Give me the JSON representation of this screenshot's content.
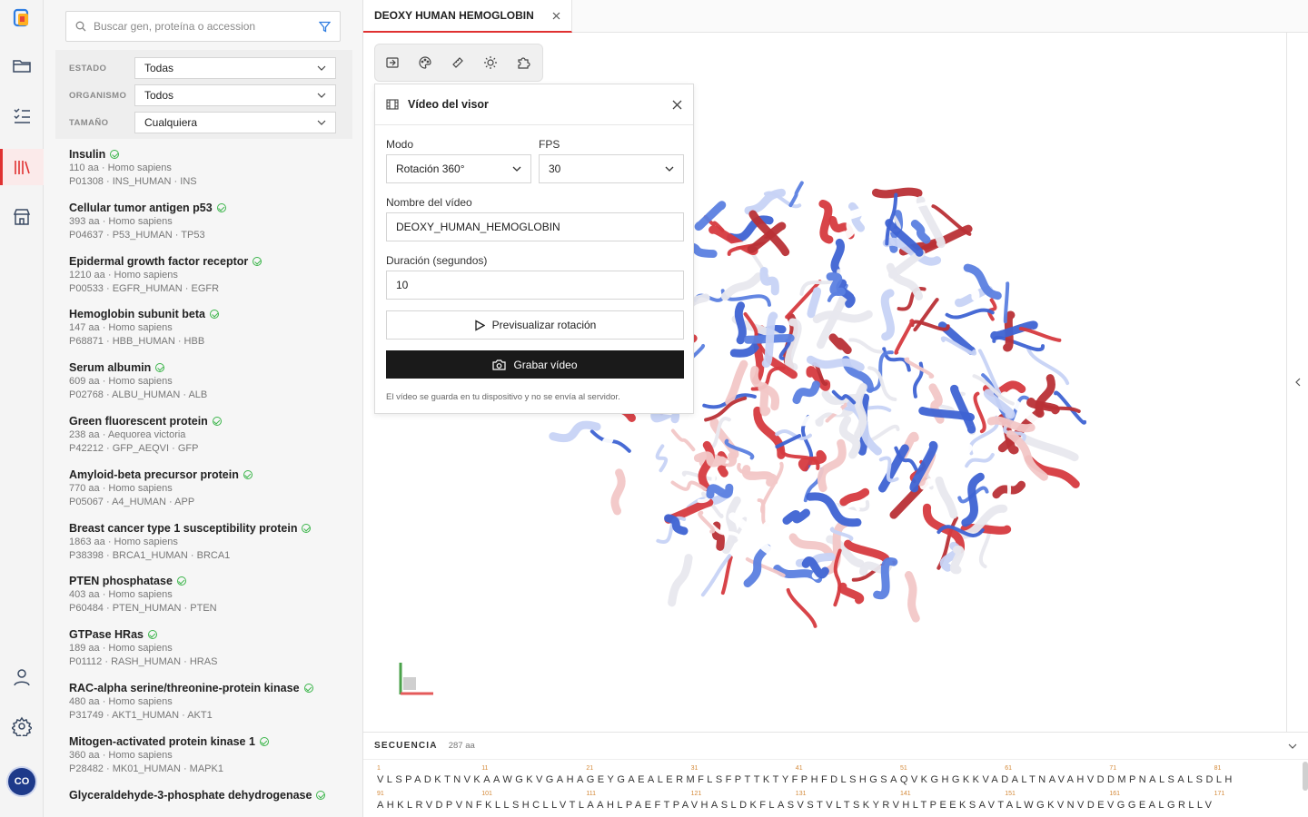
{
  "sidebar": {
    "search_placeholder": "Buscar gen, proteína o accession",
    "filters": [
      {
        "label": "ESTADO",
        "value": "Todas"
      },
      {
        "label": "ORGANISMO",
        "value": "Todos"
      },
      {
        "label": "TAMAÑO",
        "value": "Cualquiera"
      }
    ],
    "proteins": [
      {
        "name": "Insulin",
        "meta": "110 aa · Homo sapiens",
        "ids": "P01308 · INS_HUMAN · INS"
      },
      {
        "name": "Cellular tumor antigen p53",
        "meta": "393 aa · Homo sapiens",
        "ids": "P04637 · P53_HUMAN · TP53"
      },
      {
        "name": "Epidermal growth factor receptor",
        "meta": "1210 aa · Homo sapiens",
        "ids": "P00533 · EGFR_HUMAN · EGFR"
      },
      {
        "name": "Hemoglobin subunit beta",
        "meta": "147 aa · Homo sapiens",
        "ids": "P68871 · HBB_HUMAN · HBB"
      },
      {
        "name": "Serum albumin",
        "meta": "609 aa · Homo sapiens",
        "ids": "P02768 · ALBU_HUMAN · ALB"
      },
      {
        "name": "Green fluorescent protein",
        "meta": "238 aa · Aequorea victoria",
        "ids": "P42212 · GFP_AEQVI · GFP"
      },
      {
        "name": "Amyloid-beta precursor protein",
        "meta": "770 aa · Homo sapiens",
        "ids": "P05067 · A4_HUMAN · APP"
      },
      {
        "name": "Breast cancer type 1 susceptibility protein",
        "meta": "1863 aa · Homo sapiens",
        "ids": "P38398 · BRCA1_HUMAN · BRCA1"
      },
      {
        "name": "PTEN phosphatase",
        "meta": "403 aa · Homo sapiens",
        "ids": "P60484 · PTEN_HUMAN · PTEN"
      },
      {
        "name": "GTPase HRas",
        "meta": "189 aa · Homo sapiens",
        "ids": "P01112 · RASH_HUMAN · HRAS"
      },
      {
        "name": "RAC-alpha serine/threonine-protein kinase",
        "meta": "480 aa · Homo sapiens",
        "ids": "P31749 · AKT1_HUMAN · AKT1"
      },
      {
        "name": "Mitogen-activated protein kinase 1",
        "meta": "360 aa · Homo sapiens",
        "ids": "P28482 · MK01_HUMAN · MAPK1"
      },
      {
        "name": "Glyceraldehyde-3-phosphate dehydrogenase",
        "meta": "",
        "ids": ""
      }
    ]
  },
  "rail": {
    "avatar": "CO"
  },
  "tab": {
    "title": "DEOXY HUMAN HEMOGLOBIN"
  },
  "video_panel": {
    "title": "Vídeo del visor",
    "mode_label": "Modo",
    "mode_value": "Rotación 360°",
    "fps_label": "FPS",
    "fps_value": "30",
    "name_label": "Nombre del vídeo",
    "name_value": "DEOXY_HUMAN_HEMOGLOBIN",
    "duration_label": "Duración (segundos)",
    "duration_value": "10",
    "preview_label": "Previsualizar rotación",
    "record_label": "Grabar vídeo",
    "note": "El vídeo se guarda en tu dispositivo y no se envía al servidor."
  },
  "sequence": {
    "title": "SECUENCIA",
    "count": "287 aa",
    "line1": "VLSPADKTNVKAAWGKVGAHAGEYGAEALERMFLSFPTTKTYFPHFDLSHGSAQVKGHGKKVADALTNAVAHVDDMPNALSALSDLH",
    "line2": "AHKLRVDPVNFKLLSHCLLVTLAAHLPAEFTPAVHASLDKFLASVSTVLTSKYRVHLTPEEKSAVTALWGKVNVDEVGGEALGRLLV",
    "nums1": [
      "1",
      "11",
      "21",
      "31",
      "41",
      "51",
      "61",
      "71",
      "81"
    ],
    "nums2": [
      "91",
      "101",
      "111",
      "121",
      "131",
      "141",
      "151",
      "161",
      "171"
    ]
  },
  "colors": {
    "accent": "#e03131",
    "helix_red": "#d63a3f",
    "helix_blue": "#3e63d3",
    "record_button": "#1a1a1a"
  }
}
